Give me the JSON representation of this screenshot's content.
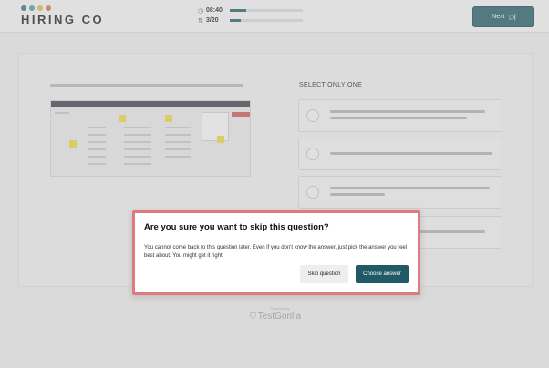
{
  "header": {
    "logo_text": "HIRING CO",
    "logo_dot_colors": [
      "#2e6f7d",
      "#4f9aa8",
      "#e4b94c",
      "#d8763f"
    ],
    "timer": {
      "icon": "clock-icon",
      "value": "08:40",
      "progress": 0.22
    },
    "question_counter": {
      "icon": "sort-arrows-icon",
      "value": "3/20",
      "progress": 0.15
    },
    "next_button": {
      "label": "Next",
      "icon": "skip-next-icon"
    }
  },
  "question": {
    "select_label": "SELECT ONLY ONE",
    "options_count_note": ""
  },
  "footer": {
    "powered_by": "Powered by",
    "brand": "TestGorilla",
    "brand_icon": "gorilla-icon"
  },
  "dialog": {
    "title": "Are you sure you want to skip this question?",
    "body": "You cannot come back to this question later. Even if you don't know the answer, just pick the answer you feel best about. You might get it right!",
    "skip_label": "Skip question",
    "choose_label": "Choose answer"
  },
  "colors": {
    "accent": "#1f5a66",
    "dialog_border": "#e07a80"
  }
}
